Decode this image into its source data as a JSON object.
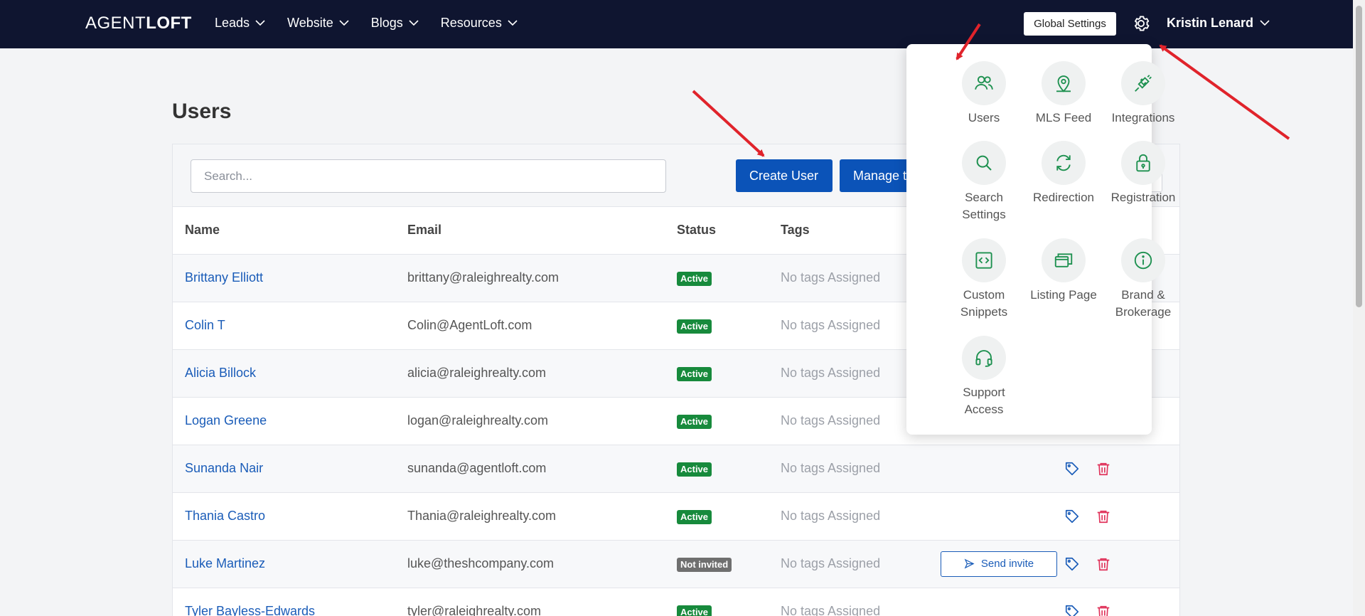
{
  "brand": {
    "logo_light": "AGENT",
    "logo_bold": "LOFT"
  },
  "nav": {
    "items": [
      {
        "label": "Leads"
      },
      {
        "label": "Website"
      },
      {
        "label": "Blogs"
      },
      {
        "label": "Resources"
      }
    ],
    "global_settings": "Global Settings",
    "user_name": "Kristin Lenard"
  },
  "page": {
    "title": "Users"
  },
  "toolbar": {
    "search_placeholder": "Search...",
    "create_user": "Create User",
    "manage_tags": "Manage tags"
  },
  "table": {
    "headers": {
      "name": "Name",
      "email": "Email",
      "status": "Status",
      "tags": "Tags"
    },
    "rows": [
      {
        "name": "Brittany Elliott",
        "email": "brittany@raleighrealty.com",
        "status": "Active",
        "tags": "No tags Assigned"
      },
      {
        "name": "Colin T",
        "email": "Colin@AgentLoft.com",
        "status": "Active",
        "tags": "No tags Assigned"
      },
      {
        "name": "Alicia Billock",
        "email": "alicia@raleighrealty.com",
        "status": "Active",
        "tags": "No tags Assigned"
      },
      {
        "name": "Logan Greene",
        "email": "logan@raleighrealty.com",
        "status": "Active",
        "tags": "No tags Assigned"
      },
      {
        "name": "Sunanda Nair",
        "email": "sunanda@agentloft.com",
        "status": "Active",
        "tags": "No tags Assigned"
      },
      {
        "name": "Thania Castro",
        "email": "Thania@raleighrealty.com",
        "status": "Active",
        "tags": "No tags Assigned"
      },
      {
        "name": "Luke Martinez",
        "email": "luke@theshcompany.com",
        "status": "Not invited",
        "tags": "No tags Assigned",
        "invite": "Send invite"
      },
      {
        "name": "Tyler Bayless-Edwards",
        "email": "tyler@raleighrealty.com",
        "status": "Active",
        "tags": "No tags Assigned"
      }
    ]
  },
  "settings_menu": {
    "items": [
      {
        "label": "Users",
        "icon": "users-icon"
      },
      {
        "label": "MLS Feed",
        "icon": "map-pin-icon"
      },
      {
        "label": "Integrations",
        "icon": "plug-icon"
      },
      {
        "label": "Search Settings",
        "icon": "search-icon"
      },
      {
        "label": "Redirection",
        "icon": "refresh-icon"
      },
      {
        "label": "Registration",
        "icon": "lock-icon"
      },
      {
        "label": "Custom Snippets",
        "icon": "code-icon"
      },
      {
        "label": "Listing Page",
        "icon": "browser-windows-icon"
      },
      {
        "label": "Brand & Brokerage",
        "icon": "info-icon"
      },
      {
        "label": "Support Access",
        "icon": "headset-icon"
      }
    ]
  },
  "colors": {
    "nav_bg": "#0f1530",
    "primary": "#0b53b8",
    "active_badge": "#178a3c",
    "menu_icon": "#1e9150",
    "trash": "#e0325a",
    "arrow": "#e0232b"
  }
}
